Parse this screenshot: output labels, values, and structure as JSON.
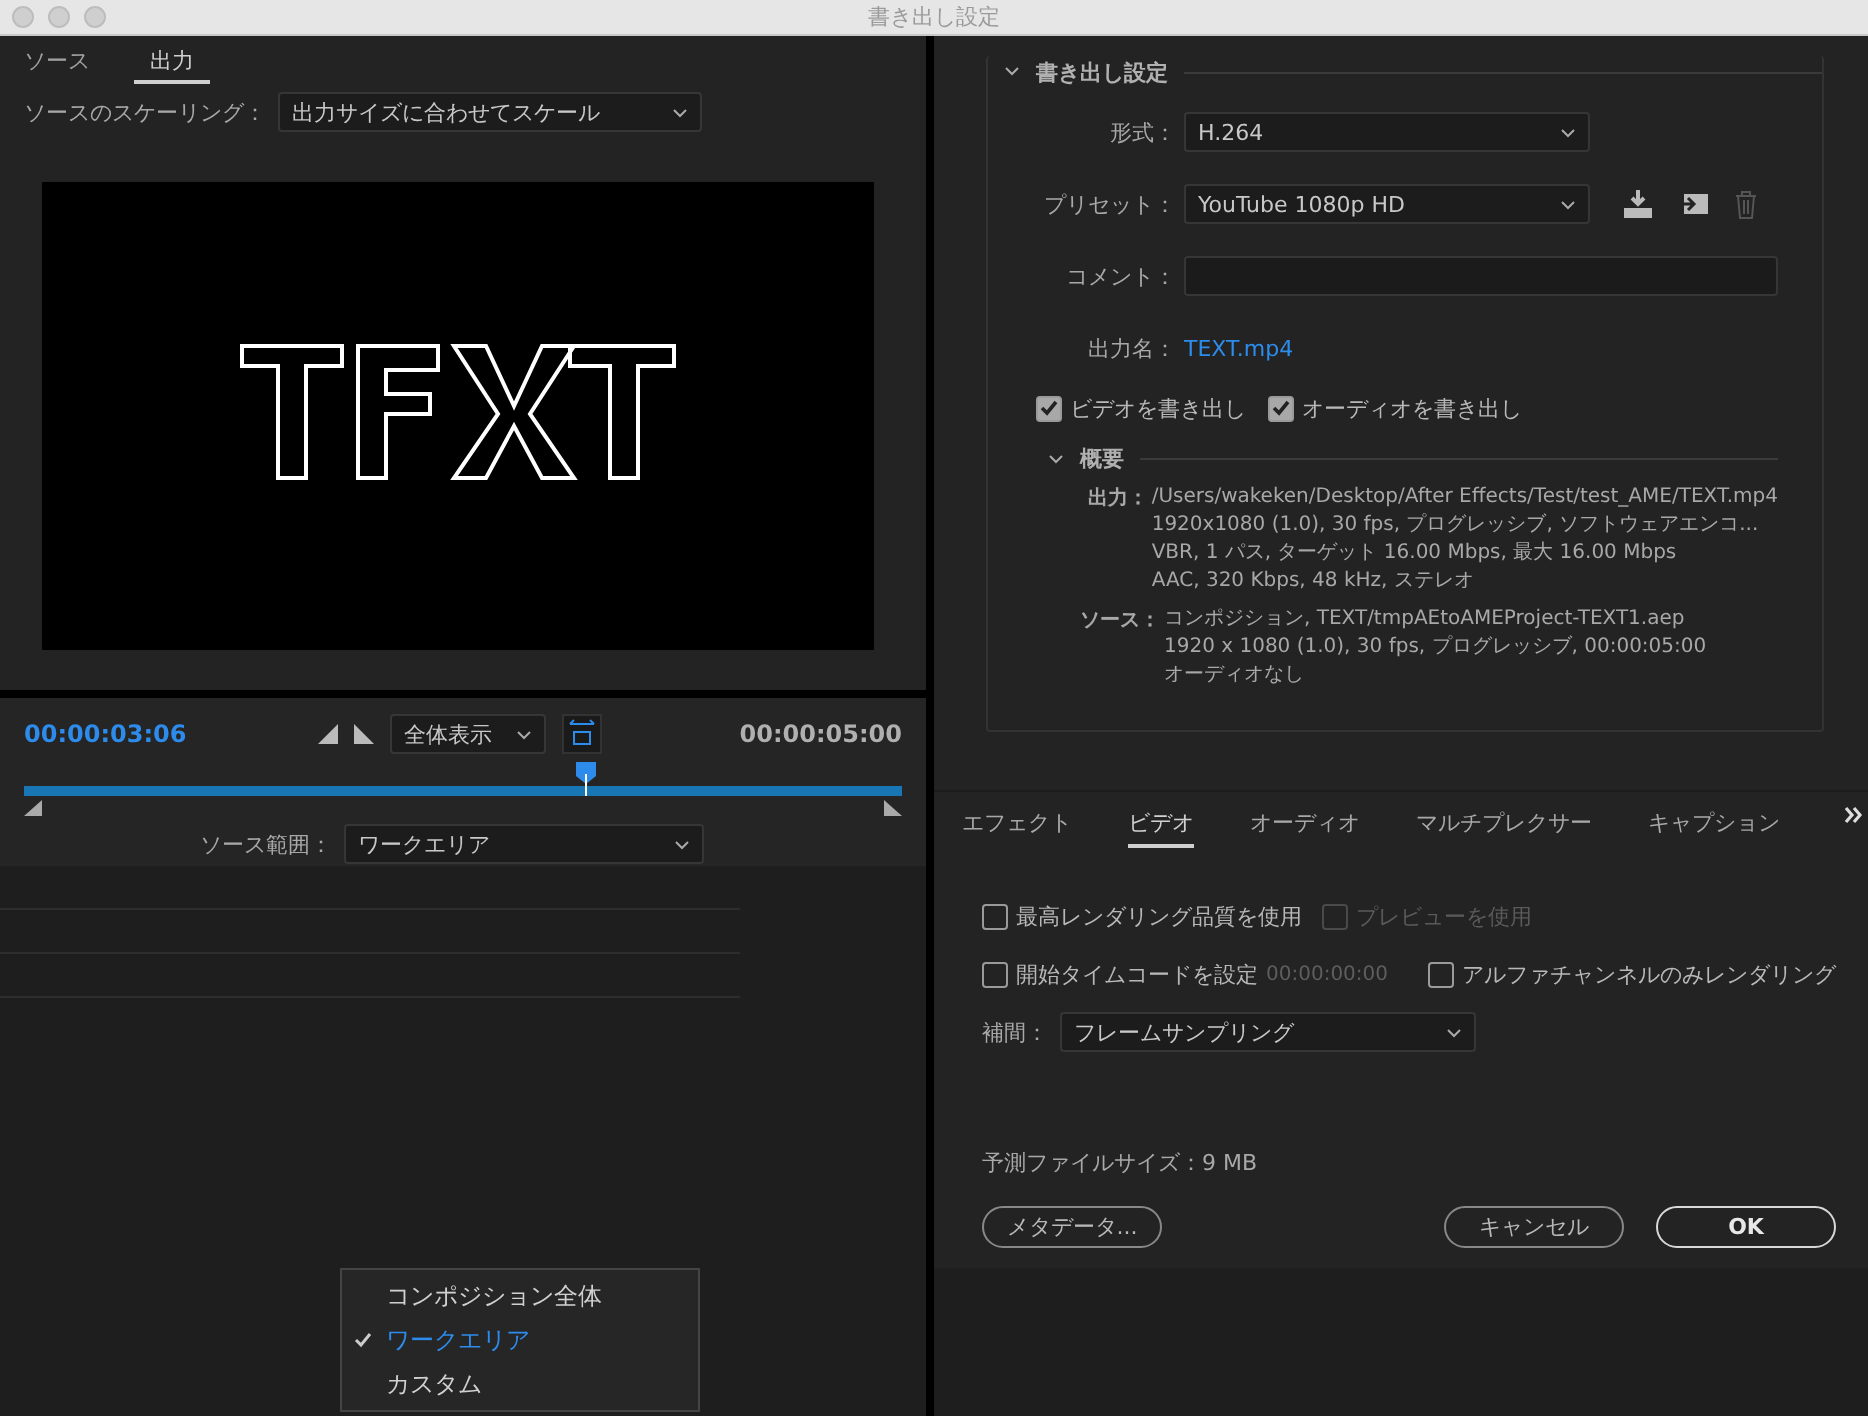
{
  "window": {
    "title": "書き出し設定"
  },
  "left_tabs": [
    {
      "label": "ソース",
      "selected": false
    },
    {
      "label": "出力",
      "selected": true
    }
  ],
  "scaling": {
    "label": "ソースのスケーリング：",
    "value": "出力サイズに合わせてスケール"
  },
  "timeline": {
    "current_time": "00:00:03:06",
    "zoom": "全体表示",
    "end_time": "00:00:05:00",
    "level": 0.64,
    "range_label": "ソース範囲：",
    "range_value": "ワークエリア"
  },
  "range_menu": [
    {
      "label": "コンポジション全体",
      "selected": false
    },
    {
      "label": "ワークエリア",
      "selected": true
    },
    {
      "label": "カスタム",
      "selected": false
    }
  ],
  "export_settings": {
    "title": "書き出し設定",
    "expanded": true,
    "fields": [
      {
        "kind": "select",
        "label": "形式：",
        "value": "H.264"
      },
      {
        "kind": "preset",
        "label": "プリセット：",
        "value": "YouTube 1080p HD"
      },
      {
        "kind": "input",
        "label": "コメント："
      },
      {
        "kind": "link",
        "label": "出力名：",
        "value": "TEXT.mp4"
      }
    ],
    "checks": [
      {
        "label": "ビデオを書き出し",
        "checked": true
      },
      {
        "label": "オーディオを書き出し",
        "checked": true
      }
    ],
    "summary": {
      "title": "概要",
      "expanded": true,
      "entries": [
        {
          "label": "出力：",
          "lines": [
            "/Users/wakeken/Desktop/After Effects/Test/test_AME/TEXT.mp4",
            "1920x1080 (1.0), 30 fps, プログレッシブ, ソフトウェアエンコ...",
            "VBR, 1 パス, ターゲット 16.00 Mbps, 最大 16.00 Mbps",
            "AAC, 320 Kbps, 48 kHz, ステレオ"
          ]
        },
        {
          "label": "ソース：",
          "lines": [
            "コンポジション, TEXT/tmpAEtoAMEProject-TEXT1.aep",
            "1920 x 1080 (1.0), 30 fps, プログレッシブ, 00:00:05:00",
            "オーディオなし"
          ]
        }
      ]
    }
  },
  "settings_tabs": [
    {
      "label": "エフェクト",
      "selected": false
    },
    {
      "label": "ビデオ",
      "selected": true
    },
    {
      "label": "オーディオ",
      "selected": false
    },
    {
      "label": "マルチプレクサー",
      "selected": false
    },
    {
      "label": "キャプション",
      "selected": false
    }
  ],
  "video_options": {
    "row1": [
      {
        "label": "最高レンダリング品質を使用",
        "checked": false,
        "disabled": false
      },
      {
        "label": "プレビューを使用",
        "checked": false,
        "disabled": true
      }
    ],
    "timecode": {
      "label": "開始タイムコードを設定",
      "checked": false,
      "value": "00:00:00:00"
    },
    "alpha": {
      "label": "アルファチャンネルのみレンダリング",
      "checked": false
    },
    "interpolation": {
      "label": "補間：",
      "value": "フレームサンプリング"
    }
  },
  "file_size": "予測ファイルサイズ：9 MB",
  "buttons": [
    {
      "kind": "secondary",
      "label": "メタデータ..."
    },
    {
      "kind": "secondary",
      "label": "キャンセル"
    },
    {
      "kind": "primary",
      "label": "OK"
    }
  ]
}
